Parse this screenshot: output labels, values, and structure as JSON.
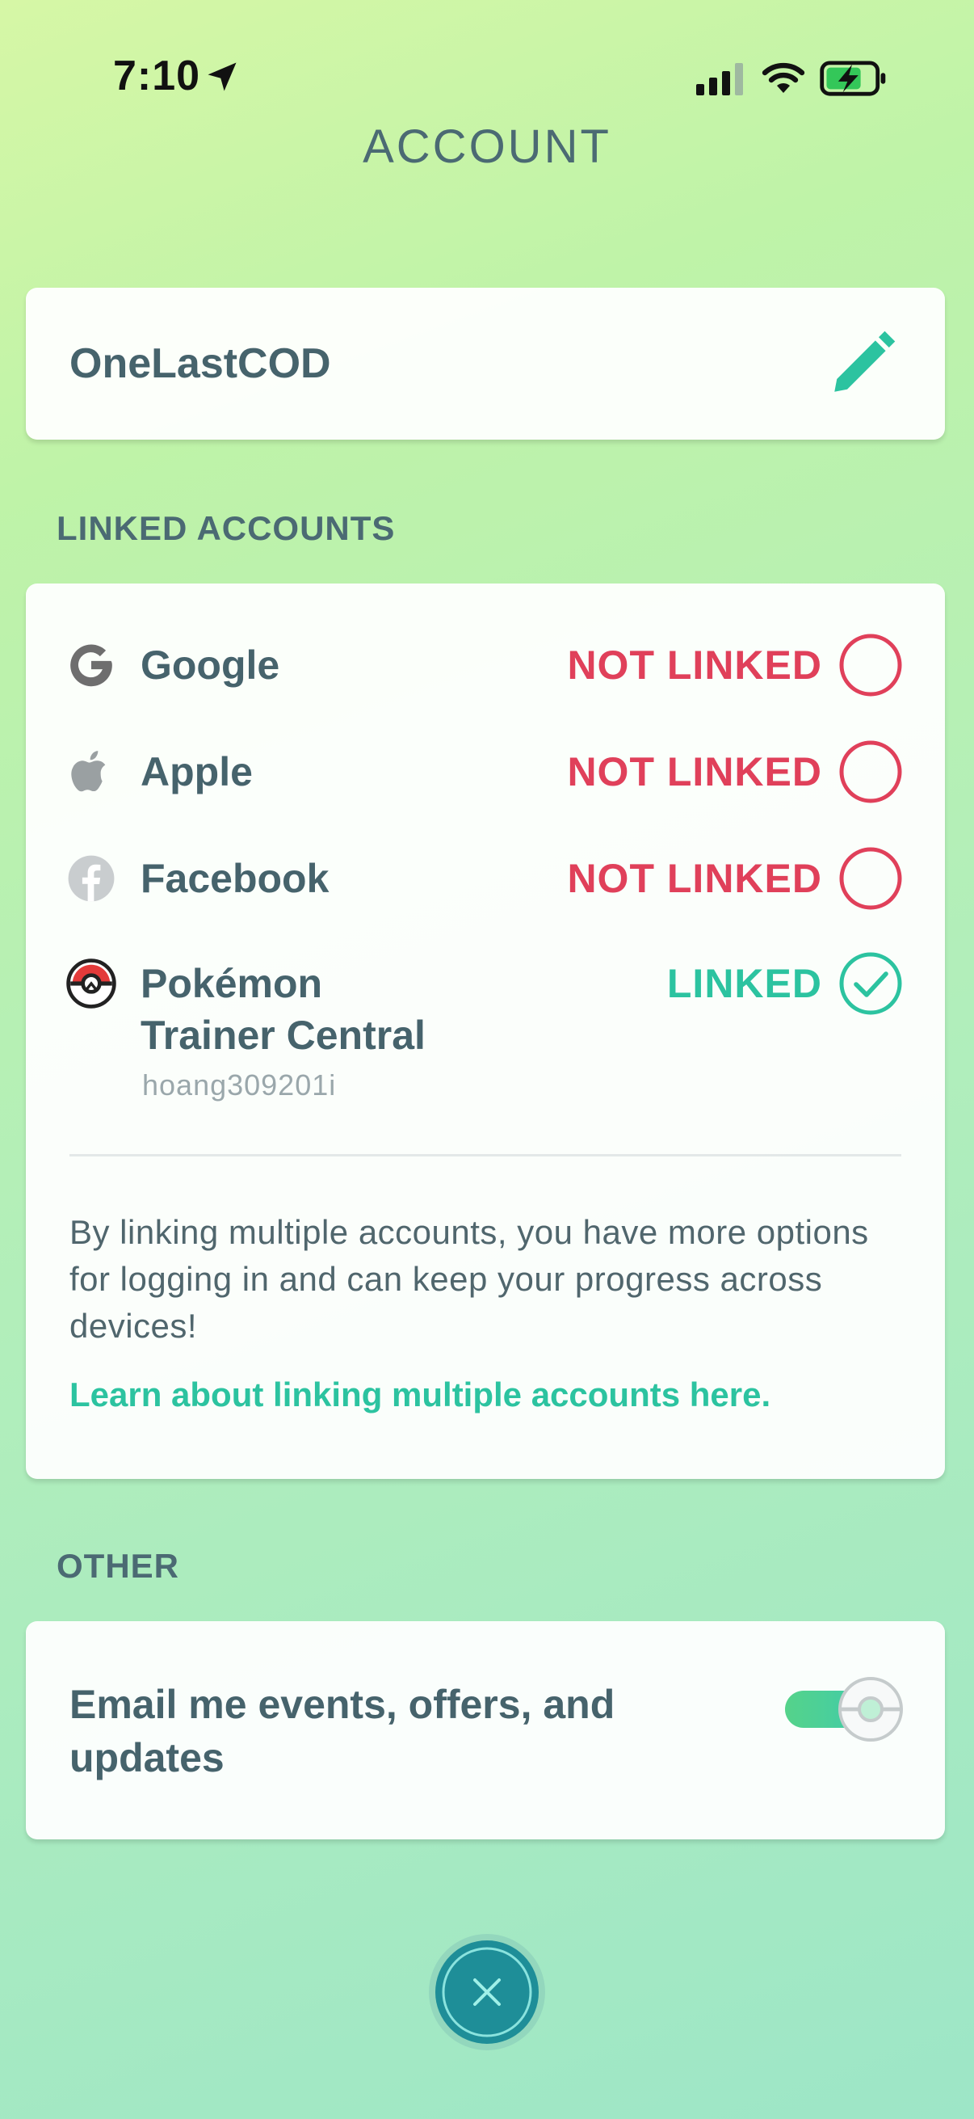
{
  "status_bar": {
    "time": "7:10"
  },
  "page_title": "ACCOUNT",
  "account": {
    "username": "OneLastCOD"
  },
  "linked_accounts": {
    "section_label": "LINKED ACCOUNTS",
    "items": [
      {
        "name": "Google",
        "status": "NOT LINKED",
        "icon": "google-icon"
      },
      {
        "name": "Apple",
        "status": "NOT LINKED",
        "icon": "apple-icon"
      },
      {
        "name": "Facebook",
        "status": "NOT LINKED",
        "icon": "facebook-icon"
      },
      {
        "name_line1": "Pokémon",
        "name_line2": "Trainer Central",
        "sub": "hoang309201i",
        "status": "LINKED",
        "icon": "pokeball-icon"
      }
    ],
    "description": "By linking multiple accounts, you have more options for logging in and can keep your progress across devices!",
    "learn_link": "Learn about linking multiple accounts here."
  },
  "other": {
    "section_label": "OTHER",
    "email_label": "Email me events, offers, and updates",
    "email_enabled": true
  },
  "colors": {
    "accent": "#2cc3a0",
    "not_linked": "#e0405a",
    "text": "#46636c"
  }
}
